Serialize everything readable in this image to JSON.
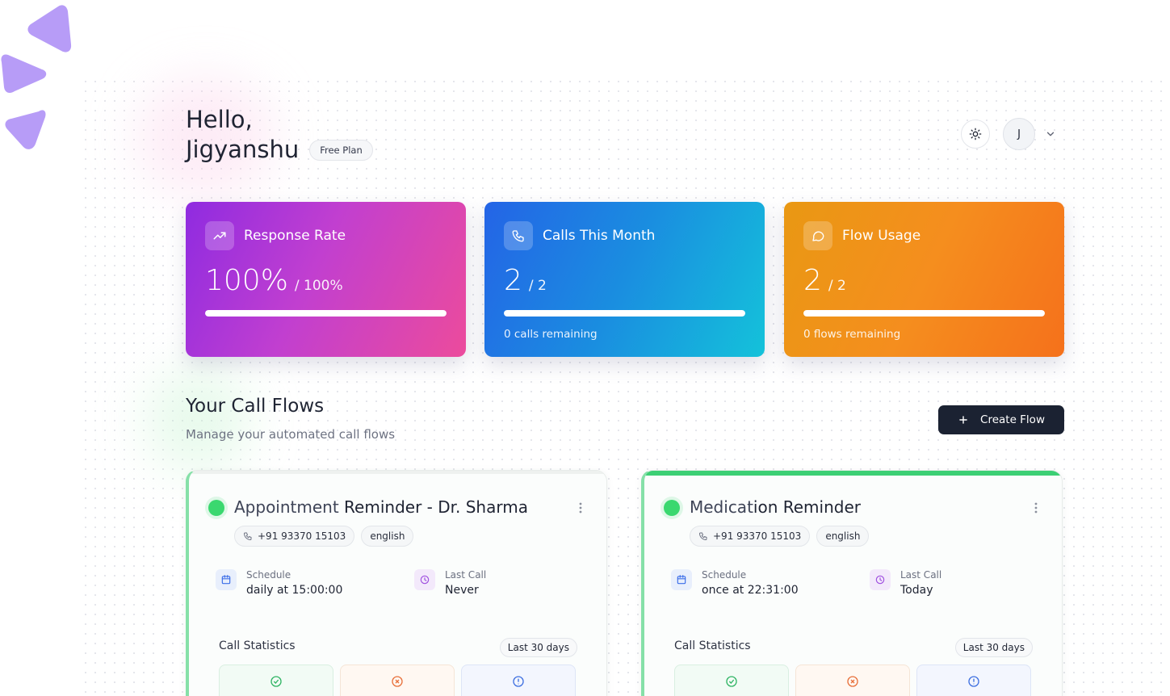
{
  "header": {
    "greeting": "Hello,",
    "user_name": "Jigyanshu",
    "plan": "Free Plan",
    "avatar_initial": "J"
  },
  "stats": [
    {
      "title": "Response Rate",
      "value": "100%",
      "total": "/ 100%",
      "progress": 1.0,
      "subtitle": "",
      "icon": "trending-up-icon"
    },
    {
      "title": "Calls This Month",
      "value": "2",
      "total": "/ 2",
      "progress": 1.0,
      "subtitle": "0 calls remaining",
      "icon": "phone-icon"
    },
    {
      "title": "Flow Usage",
      "value": "2",
      "total": "/ 2",
      "progress": 1.0,
      "subtitle": "0 flows remaining",
      "icon": "chat-icon"
    }
  ],
  "section": {
    "title": "Your Call Flows",
    "subtitle": "Manage your automated call flows",
    "create_label": "Create Flow"
  },
  "flows": [
    {
      "title_light": "Appointment",
      "title_rest": " Reminder - Dr. Sharma",
      "phone": "+91 93370 15103",
      "language": "english",
      "schedule_label": "Schedule",
      "schedule_value": "daily at 15:00:00",
      "last_call_label": "Last Call",
      "last_call_value": "Never",
      "stats_label": "Call Statistics",
      "range": "Last 30 days"
    },
    {
      "title_light": "Medicat",
      "title_rest": "ion Reminder",
      "phone": "+91 93370 15103",
      "language": "english",
      "schedule_label": "Schedule",
      "schedule_value": "once at 22:31:00",
      "last_call_label": "Last Call",
      "last_call_value": "Today",
      "stats_label": "Call Statistics",
      "range": "Last 30 days"
    }
  ],
  "colors": {
    "accent_dark": "#1b2232",
    "status_green": "#3ad86f",
    "logo_purple": "#b79cf7"
  }
}
